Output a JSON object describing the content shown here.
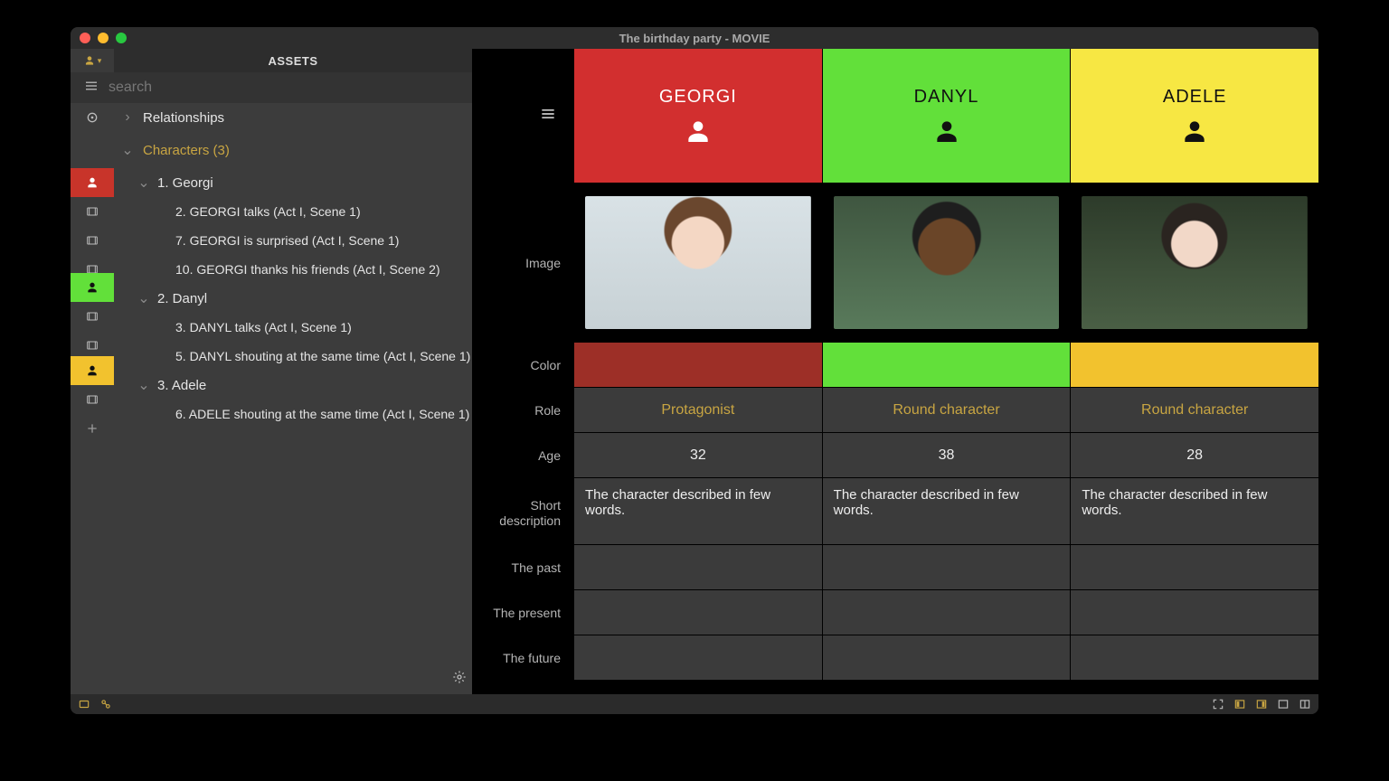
{
  "window": {
    "title": "The birthday party - MOVIE"
  },
  "sidebar": {
    "title": "ASSETS",
    "search_placeholder": "search",
    "relationships_label": "Relationships",
    "characters_label": "Characters (3)",
    "characters": [
      {
        "label": "1. Georgi",
        "color": "#c8342a",
        "scenes": [
          "2. GEORGI talks (Act I, Scene 1)",
          "7. GEORGI is surprised (Act I, Scene 1)",
          "10. GEORGI thanks his friends (Act I, Scene 2)"
        ]
      },
      {
        "label": "2. Danyl",
        "color": "#62e03a",
        "scenes": [
          "3. DANYL talks (Act I, Scene 1)",
          "5. DANYL shouting at the same time (Act I, Scene 1)"
        ]
      },
      {
        "label": "3. Adele",
        "color": "#f2c22e",
        "scenes": [
          "6. ADELE shouting at the same time (Act I, Scene 1)"
        ]
      }
    ]
  },
  "grid": {
    "attrs": {
      "image": "Image",
      "color": "Color",
      "role": "Role",
      "age": "Age",
      "short_desc": "Short description",
      "past": "The past",
      "present": "The present",
      "future": "The future"
    },
    "characters": [
      {
        "name": "GEORGI",
        "header_bg": "#d22f2f",
        "header_fg": "#ffffff",
        "icon_fg": "#ffffff",
        "color": "#9d2f27",
        "role": "Protagonist",
        "age": "32",
        "short_desc": "The character described in few words.",
        "past": "",
        "present": "",
        "future": ""
      },
      {
        "name": "DANYL",
        "header_bg": "#62e03a",
        "header_fg": "#111111",
        "icon_fg": "#111111",
        "color": "#62e03a",
        "role": "Round character",
        "age": "38",
        "short_desc": "The character described in few words.",
        "past": "",
        "present": "",
        "future": ""
      },
      {
        "name": "ADELE",
        "header_bg": "#f7e743",
        "header_fg": "#111111",
        "icon_fg": "#111111",
        "color": "#f2c22e",
        "role": "Round character",
        "age": "28",
        "short_desc": "The character described in few words.",
        "past": "",
        "present": "",
        "future": ""
      }
    ]
  }
}
